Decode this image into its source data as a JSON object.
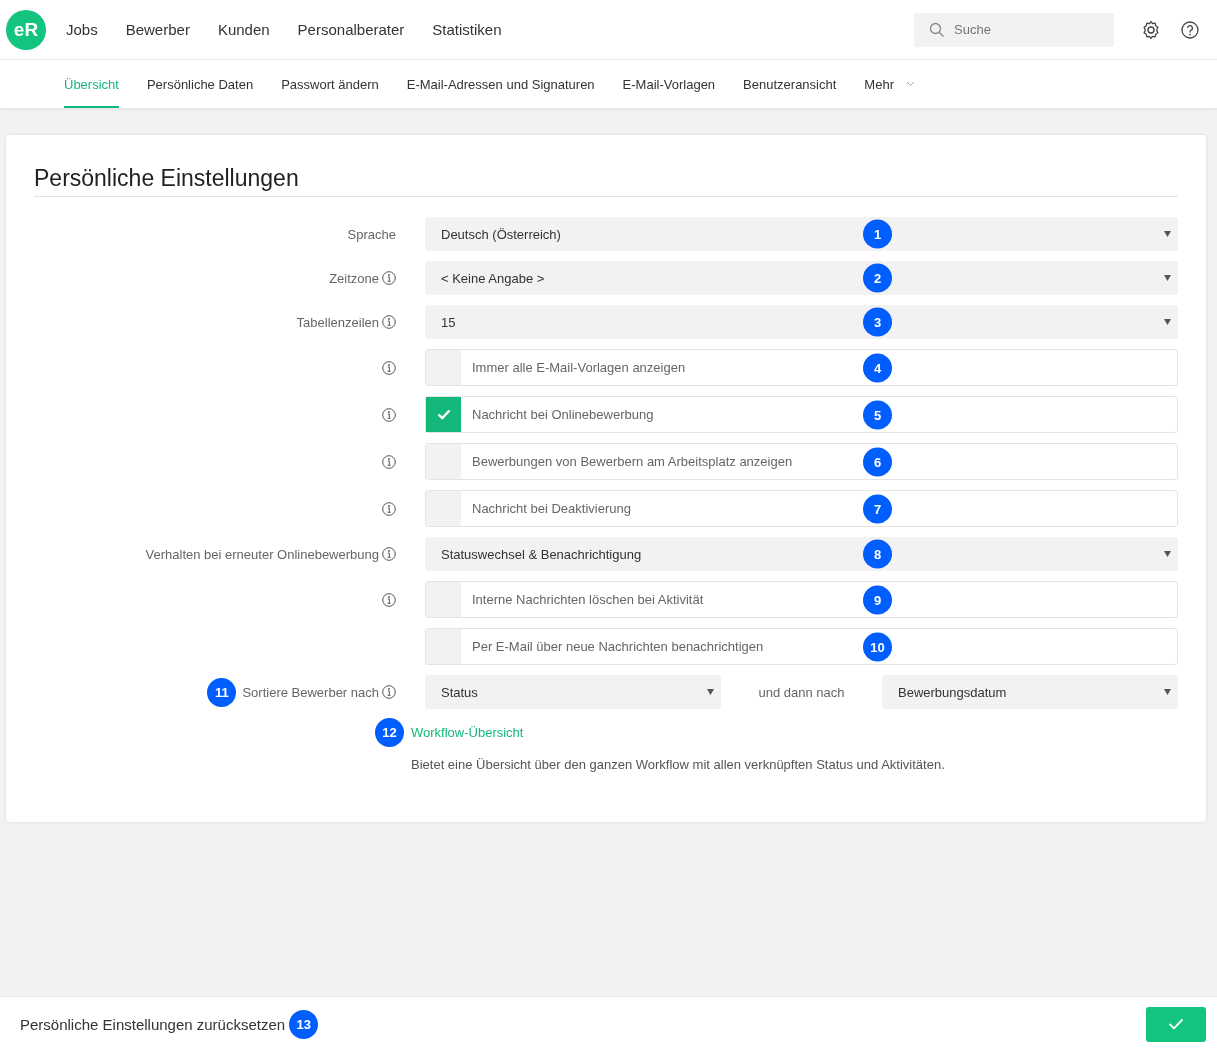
{
  "nav": {
    "logo": "eR",
    "items": [
      "Jobs",
      "Bewerber",
      "Kunden",
      "Personalberater",
      "Statistiken"
    ],
    "search": {
      "placeholder": "Suche"
    }
  },
  "tabs": [
    {
      "label": "Übersicht",
      "selected": true
    },
    {
      "label": "Persönliche Daten",
      "selected": false
    },
    {
      "label": "Passwort ändern",
      "selected": false
    },
    {
      "label": "E-Mail-Adressen und Signaturen",
      "selected": false
    },
    {
      "label": "E-Mail-Vorlagen",
      "selected": false
    },
    {
      "label": "Benutzeransicht",
      "selected": false
    },
    {
      "label": "Mehr",
      "selected": false,
      "dropdown": true
    }
  ],
  "settings": {
    "title": "Persönliche Einstellungen",
    "rows": [
      {
        "kind": "select",
        "label": "Sprache",
        "info": false,
        "value": "Deutsch (Österreich)",
        "marker": "1"
      },
      {
        "kind": "select",
        "label": "Zeitzone",
        "info": true,
        "value": "< Keine Angabe >",
        "marker": "2"
      },
      {
        "kind": "select",
        "label": "Tabellenzeilen",
        "info": true,
        "value": "15",
        "marker": "3"
      },
      {
        "kind": "checkbox",
        "info": true,
        "text": "Immer alle E-Mail-Vorlagen anzeigen",
        "checked": false,
        "marker": "4"
      },
      {
        "kind": "checkbox",
        "info": true,
        "text": "Nachricht bei Onlinebewerbung",
        "checked": true,
        "marker": "5"
      },
      {
        "kind": "checkbox",
        "info": true,
        "text": "Bewerbungen von Bewerbern am Arbeitsplatz anzeigen",
        "checked": false,
        "marker": "6"
      },
      {
        "kind": "checkbox",
        "info": true,
        "text": "Nachricht bei Deaktivierung",
        "checked": false,
        "marker": "7"
      },
      {
        "kind": "select",
        "label": "Verhalten bei erneuter Onlinebewerbung",
        "info": true,
        "value": "Statuswechsel & Benachrichtigung",
        "marker": "8"
      },
      {
        "kind": "checkbox",
        "info": true,
        "text": "Interne Nachrichten löschen bei Aktivität",
        "checked": false,
        "marker": "9"
      },
      {
        "kind": "checkbox",
        "info": false,
        "text": "Per E-Mail über neue Nachrichten benachrichtigen",
        "checked": false,
        "marker": "10"
      },
      {
        "kind": "sort",
        "label": "Sortiere Bewerber nach",
        "info": true,
        "value": "Status",
        "then_label": "und dann nach",
        "then_value": "Bewerbungsdatum",
        "marker": "11"
      }
    ],
    "workflow": {
      "marker": "12",
      "link": "Workflow-Übersicht",
      "description": "Bietet eine Übersicht über den ganzen Workflow mit allen verknüpften Status und Aktivitäten."
    }
  },
  "footer": {
    "reset": "Persönliche Einstellungen zurücksetzen",
    "marker": "13"
  }
}
